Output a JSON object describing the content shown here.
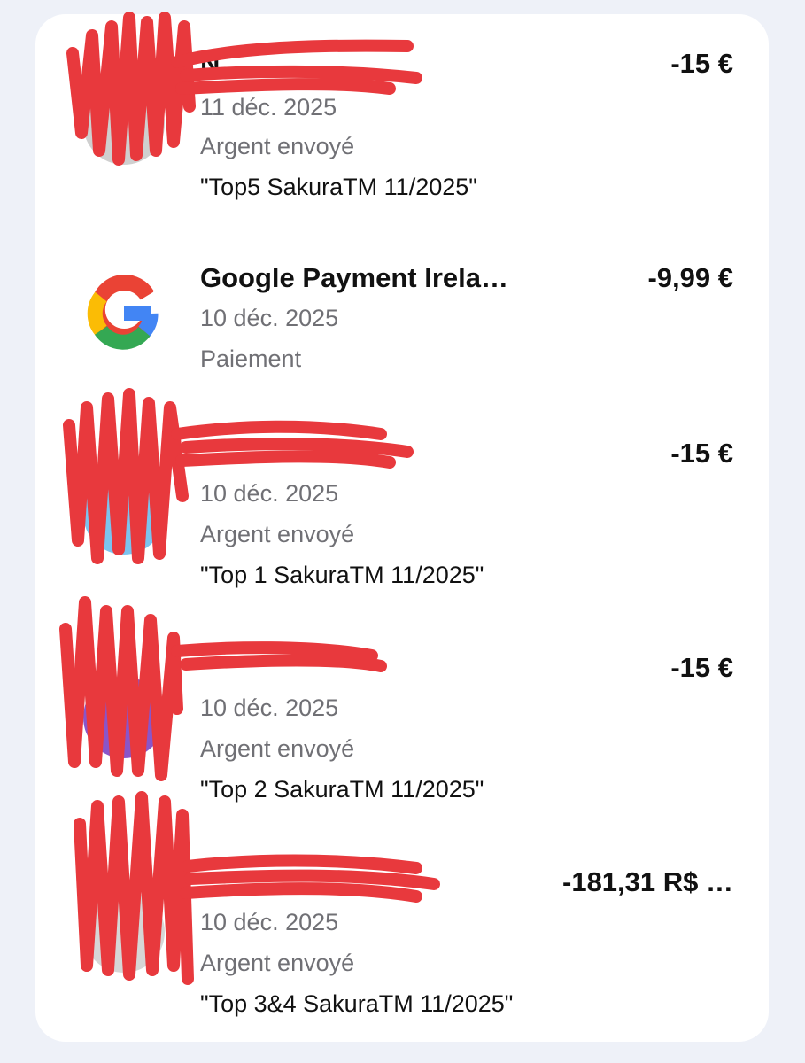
{
  "transactions": [
    {
      "name": "N",
      "amount": "-15 €",
      "date": "11 déc. 2025",
      "type": "Argent envoyé",
      "note": "\"Top5 SakuraTM 11/2025\"",
      "avatar": "redacted-avatar"
    },
    {
      "name": "Google Payment Irela…",
      "amount": "-9,99 €",
      "date": "10 déc. 2025",
      "type": "Paiement",
      "note": "",
      "avatar": "google-logo-icon"
    },
    {
      "name": "",
      "amount": "-15 €",
      "date": "10 déc. 2025",
      "type": "Argent envoyé",
      "note": "\"Top 1 SakuraTM 11/2025\"",
      "avatar": "redacted-avatar"
    },
    {
      "name": "",
      "amount": "-15 €",
      "date": "10 déc. 2025",
      "type": "Argent envoyé",
      "note": "\"Top 2 SakuraTM 11/2025\"",
      "avatar": "redacted-avatar"
    },
    {
      "name": "",
      "amount": "-181,31 R$ …",
      "date": "10 déc. 2025",
      "type": "Argent envoyé",
      "note": "\"Top 3&4 SakuraTM 11/2025\"",
      "avatar": "redacted-avatar"
    }
  ],
  "colors": {
    "background": "#eef1f8",
    "card": "#ffffff",
    "redaction": "#e8393d",
    "secondary_text": "#707075"
  }
}
